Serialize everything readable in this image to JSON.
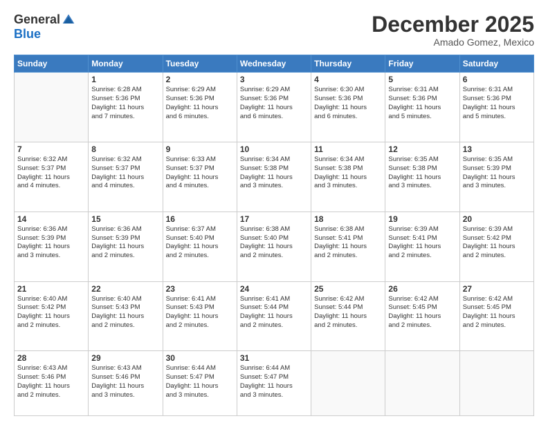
{
  "logo": {
    "general": "General",
    "blue": "Blue"
  },
  "header": {
    "month": "December 2025",
    "location": "Amado Gomez, Mexico"
  },
  "days": [
    "Sunday",
    "Monday",
    "Tuesday",
    "Wednesday",
    "Thursday",
    "Friday",
    "Saturday"
  ],
  "weeks": [
    [
      {
        "day": "",
        "info": ""
      },
      {
        "day": "1",
        "info": "Sunrise: 6:28 AM\nSunset: 5:36 PM\nDaylight: 11 hours\nand 7 minutes."
      },
      {
        "day": "2",
        "info": "Sunrise: 6:29 AM\nSunset: 5:36 PM\nDaylight: 11 hours\nand 6 minutes."
      },
      {
        "day": "3",
        "info": "Sunrise: 6:29 AM\nSunset: 5:36 PM\nDaylight: 11 hours\nand 6 minutes."
      },
      {
        "day": "4",
        "info": "Sunrise: 6:30 AM\nSunset: 5:36 PM\nDaylight: 11 hours\nand 6 minutes."
      },
      {
        "day": "5",
        "info": "Sunrise: 6:31 AM\nSunset: 5:36 PM\nDaylight: 11 hours\nand 5 minutes."
      },
      {
        "day": "6",
        "info": "Sunrise: 6:31 AM\nSunset: 5:36 PM\nDaylight: 11 hours\nand 5 minutes."
      }
    ],
    [
      {
        "day": "7",
        "info": "Sunrise: 6:32 AM\nSunset: 5:37 PM\nDaylight: 11 hours\nand 4 minutes."
      },
      {
        "day": "8",
        "info": "Sunrise: 6:32 AM\nSunset: 5:37 PM\nDaylight: 11 hours\nand 4 minutes."
      },
      {
        "day": "9",
        "info": "Sunrise: 6:33 AM\nSunset: 5:37 PM\nDaylight: 11 hours\nand 4 minutes."
      },
      {
        "day": "10",
        "info": "Sunrise: 6:34 AM\nSunset: 5:38 PM\nDaylight: 11 hours\nand 3 minutes."
      },
      {
        "day": "11",
        "info": "Sunrise: 6:34 AM\nSunset: 5:38 PM\nDaylight: 11 hours\nand 3 minutes."
      },
      {
        "day": "12",
        "info": "Sunrise: 6:35 AM\nSunset: 5:38 PM\nDaylight: 11 hours\nand 3 minutes."
      },
      {
        "day": "13",
        "info": "Sunrise: 6:35 AM\nSunset: 5:39 PM\nDaylight: 11 hours\nand 3 minutes."
      }
    ],
    [
      {
        "day": "14",
        "info": "Sunrise: 6:36 AM\nSunset: 5:39 PM\nDaylight: 11 hours\nand 3 minutes."
      },
      {
        "day": "15",
        "info": "Sunrise: 6:36 AM\nSunset: 5:39 PM\nDaylight: 11 hours\nand 2 minutes."
      },
      {
        "day": "16",
        "info": "Sunrise: 6:37 AM\nSunset: 5:40 PM\nDaylight: 11 hours\nand 2 minutes."
      },
      {
        "day": "17",
        "info": "Sunrise: 6:38 AM\nSunset: 5:40 PM\nDaylight: 11 hours\nand 2 minutes."
      },
      {
        "day": "18",
        "info": "Sunrise: 6:38 AM\nSunset: 5:41 PM\nDaylight: 11 hours\nand 2 minutes."
      },
      {
        "day": "19",
        "info": "Sunrise: 6:39 AM\nSunset: 5:41 PM\nDaylight: 11 hours\nand 2 minutes."
      },
      {
        "day": "20",
        "info": "Sunrise: 6:39 AM\nSunset: 5:42 PM\nDaylight: 11 hours\nand 2 minutes."
      }
    ],
    [
      {
        "day": "21",
        "info": "Sunrise: 6:40 AM\nSunset: 5:42 PM\nDaylight: 11 hours\nand 2 minutes."
      },
      {
        "day": "22",
        "info": "Sunrise: 6:40 AM\nSunset: 5:43 PM\nDaylight: 11 hours\nand 2 minutes."
      },
      {
        "day": "23",
        "info": "Sunrise: 6:41 AM\nSunset: 5:43 PM\nDaylight: 11 hours\nand 2 minutes."
      },
      {
        "day": "24",
        "info": "Sunrise: 6:41 AM\nSunset: 5:44 PM\nDaylight: 11 hours\nand 2 minutes."
      },
      {
        "day": "25",
        "info": "Sunrise: 6:42 AM\nSunset: 5:44 PM\nDaylight: 11 hours\nand 2 minutes."
      },
      {
        "day": "26",
        "info": "Sunrise: 6:42 AM\nSunset: 5:45 PM\nDaylight: 11 hours\nand 2 minutes."
      },
      {
        "day": "27",
        "info": "Sunrise: 6:42 AM\nSunset: 5:45 PM\nDaylight: 11 hours\nand 2 minutes."
      }
    ],
    [
      {
        "day": "28",
        "info": "Sunrise: 6:43 AM\nSunset: 5:46 PM\nDaylight: 11 hours\nand 2 minutes."
      },
      {
        "day": "29",
        "info": "Sunrise: 6:43 AM\nSunset: 5:46 PM\nDaylight: 11 hours\nand 3 minutes."
      },
      {
        "day": "30",
        "info": "Sunrise: 6:44 AM\nSunset: 5:47 PM\nDaylight: 11 hours\nand 3 minutes."
      },
      {
        "day": "31",
        "info": "Sunrise: 6:44 AM\nSunset: 5:47 PM\nDaylight: 11 hours\nand 3 minutes."
      },
      {
        "day": "",
        "info": ""
      },
      {
        "day": "",
        "info": ""
      },
      {
        "day": "",
        "info": ""
      }
    ]
  ]
}
